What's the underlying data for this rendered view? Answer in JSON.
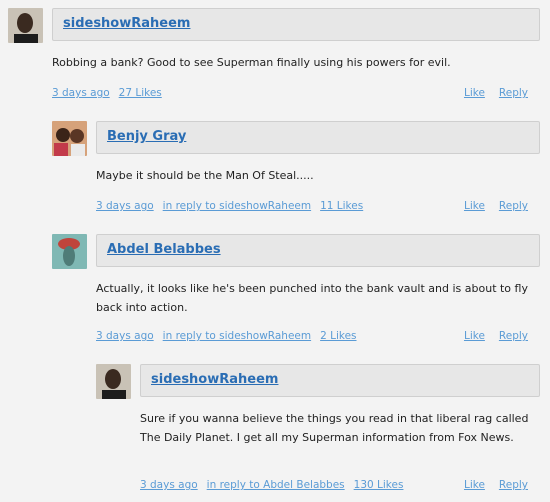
{
  "comments": [
    {
      "author": "sideshowRaheem",
      "text": "Robbing a bank? Good to see Superman finally using his powers for evil.",
      "time": "3 days ago",
      "reply_to": "",
      "likes": "27 Likes",
      "like_label": "Like",
      "reply_label": "Reply"
    },
    {
      "author": "Benjy Gray",
      "text": "Maybe it should be the Man Of Steal.....",
      "time": "3 days ago",
      "reply_to": "in reply to sideshowRaheem",
      "likes": "11 Likes",
      "like_label": "Like",
      "reply_label": "Reply"
    },
    {
      "author": "Abdel Belabbes",
      "text": "Actually, it looks like he's been punched into the bank vault and is about to fly back into action.",
      "time": "3 days ago",
      "reply_to": "in reply to sideshowRaheem",
      "likes": "2 Likes",
      "like_label": "Like",
      "reply_label": "Reply"
    },
    {
      "author": "sideshowRaheem",
      "text": "Sure if you wanna believe the things you read in that liberal rag called The Daily Planet. I get all my Superman information from Fox News.",
      "time": "3 days ago",
      "reply_to": "in reply to Abdel Belabbes",
      "likes": "130 Likes",
      "like_label": "Like",
      "reply_label": "Reply"
    }
  ],
  "colors": {
    "link": "#5a9bd5",
    "author": "#2a6db4",
    "namebar": "#e7e7e7",
    "background": "#f3f3f3"
  }
}
